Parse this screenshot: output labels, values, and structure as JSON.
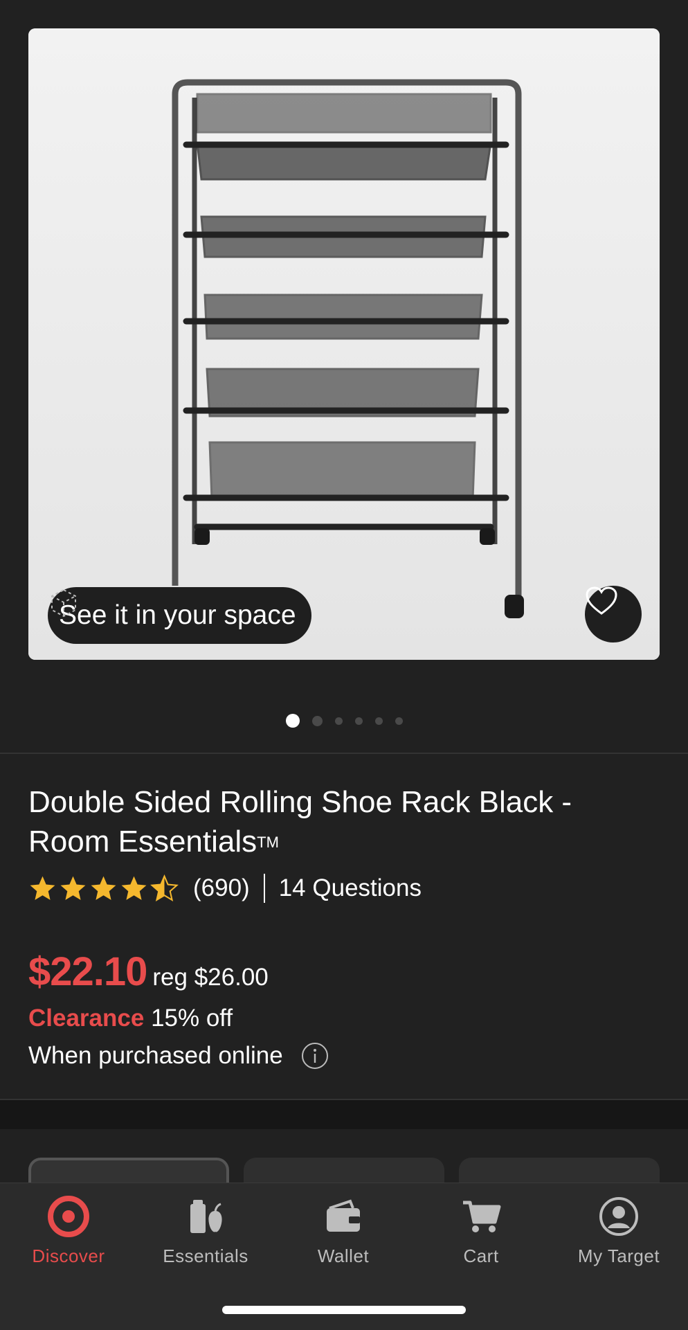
{
  "product": {
    "ar_label": "See it in your space",
    "title": "Double Sided Rolling Shoe Rack Black - Room Essentials",
    "trademark": "TM",
    "rating": 4.5,
    "rating_max": 5,
    "review_count": "(690)",
    "questions": "14 Questions",
    "price": "$22.10",
    "reg_price": "reg $26.00",
    "clearance_label": "Clearance",
    "discount": "15% off",
    "online_note": "When purchased online"
  },
  "carousel": {
    "total": 6,
    "active_index": 0
  },
  "tabbar": {
    "items": [
      {
        "label": "Discover",
        "icon": "target-logo-icon",
        "active": true
      },
      {
        "label": "Essentials",
        "icon": "essentials-icon",
        "active": false
      },
      {
        "label": "Wallet",
        "icon": "wallet-icon",
        "active": false
      },
      {
        "label": "Cart",
        "icon": "cart-icon",
        "active": false
      },
      {
        "label": "My Target",
        "icon": "account-icon",
        "active": false
      }
    ]
  },
  "colors": {
    "accent": "#e84c4c",
    "background": "#212121",
    "star": "#f5b82e"
  }
}
